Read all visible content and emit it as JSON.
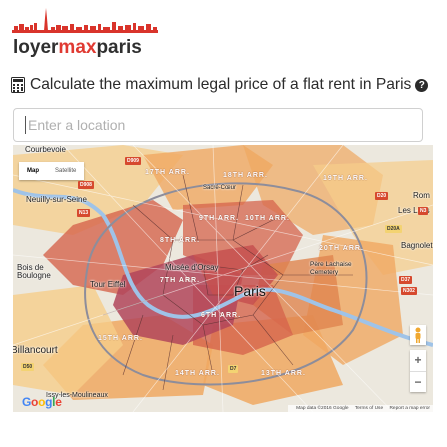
{
  "brand": {
    "part1": "loyer",
    "part2": "max",
    "part3": "paris",
    "accent": "#e03a32"
  },
  "heading": {
    "text": "Calculate the maximum legal price of a flat rent in Paris",
    "icon": "calculator-icon",
    "help": "?"
  },
  "location": {
    "placeholder": "Enter a location",
    "value": ""
  },
  "map": {
    "type_control": {
      "map": "Map",
      "satellite": "Satellite",
      "selected": "Map"
    },
    "center_label": "Paris",
    "places": [
      {
        "id": "courbevoie",
        "name": "Courbevoie"
      },
      {
        "id": "neuilly",
        "name": "Neuilly-sur-Seine"
      },
      {
        "id": "bois",
        "name": "Bois de\nBoulogne"
      },
      {
        "id": "eiffel",
        "name": "Tour Eiffel"
      },
      {
        "id": "billancourt",
        "name": "Billancourt"
      },
      {
        "id": "moulineaux",
        "name": "Issy-les-Moulineaux"
      },
      {
        "id": "orsay",
        "name": "Musée d'Orsay"
      },
      {
        "id": "lachaise",
        "name": "Père Lachaise\nCemetery"
      },
      {
        "id": "coeur",
        "name": "Sacré-Cœur"
      },
      {
        "id": "lilas",
        "name": "Les Lilas"
      },
      {
        "id": "bagnolet",
        "name": "Bagnolet"
      },
      {
        "id": "rom",
        "name": "Rom"
      }
    ],
    "arrondissements": [
      "17TH ARR.",
      "18TH ARR.",
      "19TH ARR.",
      "9TH ARR.",
      "10TH ARR.",
      "8TH ARR.",
      "20TH ARR.",
      "7TH ARR.",
      "6TH ARR.",
      "15TH ARR.",
      "14TH ARR.",
      "13TH ARR."
    ],
    "roads": [
      "D909",
      "D908",
      "N13",
      "D20",
      "N3",
      "D20A",
      "D37",
      "N302",
      "D50",
      "D7"
    ],
    "zoom": {
      "in": "+",
      "out": "−"
    },
    "attribution": {
      "data": "Map data ©2016 Google",
      "terms": "Terms of Use",
      "report": "Report a map error"
    },
    "google": [
      "G",
      "o",
      "o",
      "g",
      "l",
      "e"
    ],
    "colors": {
      "high": "#b2455a",
      "mid": "#d6644c",
      "low": "#f0a861",
      "lowest": "#f6cd8a"
    }
  }
}
